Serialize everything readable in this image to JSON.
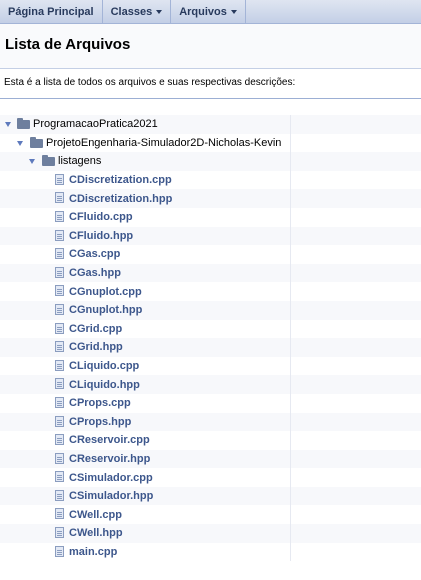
{
  "nav": {
    "items": [
      {
        "label": "Página Principal",
        "dropdown": false
      },
      {
        "label": "Classes",
        "dropdown": true
      },
      {
        "label": "Arquivos",
        "dropdown": true
      }
    ]
  },
  "header": {
    "title": "Lista de Arquivos"
  },
  "intro": "Esta é a lista de todos os arquivos e suas respectivas descrições:",
  "tree": {
    "root": "ProgramacaoPratica2021",
    "project": "ProjetoEngenharia-Simulador2D-Nicholas-Kevin",
    "folder": "listagens",
    "files": [
      "CDiscretization.cpp",
      "CDiscretization.hpp",
      "CFluido.cpp",
      "CFluido.hpp",
      "CGas.cpp",
      "CGas.hpp",
      "CGnuplot.cpp",
      "CGnuplot.hpp",
      "CGrid.cpp",
      "CGrid.hpp",
      "CLiquido.cpp",
      "CLiquido.hpp",
      "CProps.cpp",
      "CProps.hpp",
      "CReservoir.cpp",
      "CReservoir.hpp",
      "CSimulador.cpp",
      "CSimulador.hpp",
      "CWell.cpp",
      "CWell.hpp",
      "main.cpp"
    ]
  },
  "colors": {
    "link": "#3d578c",
    "nav_bg": "#c3cfe6",
    "row_alt": "#f7f8fb"
  }
}
